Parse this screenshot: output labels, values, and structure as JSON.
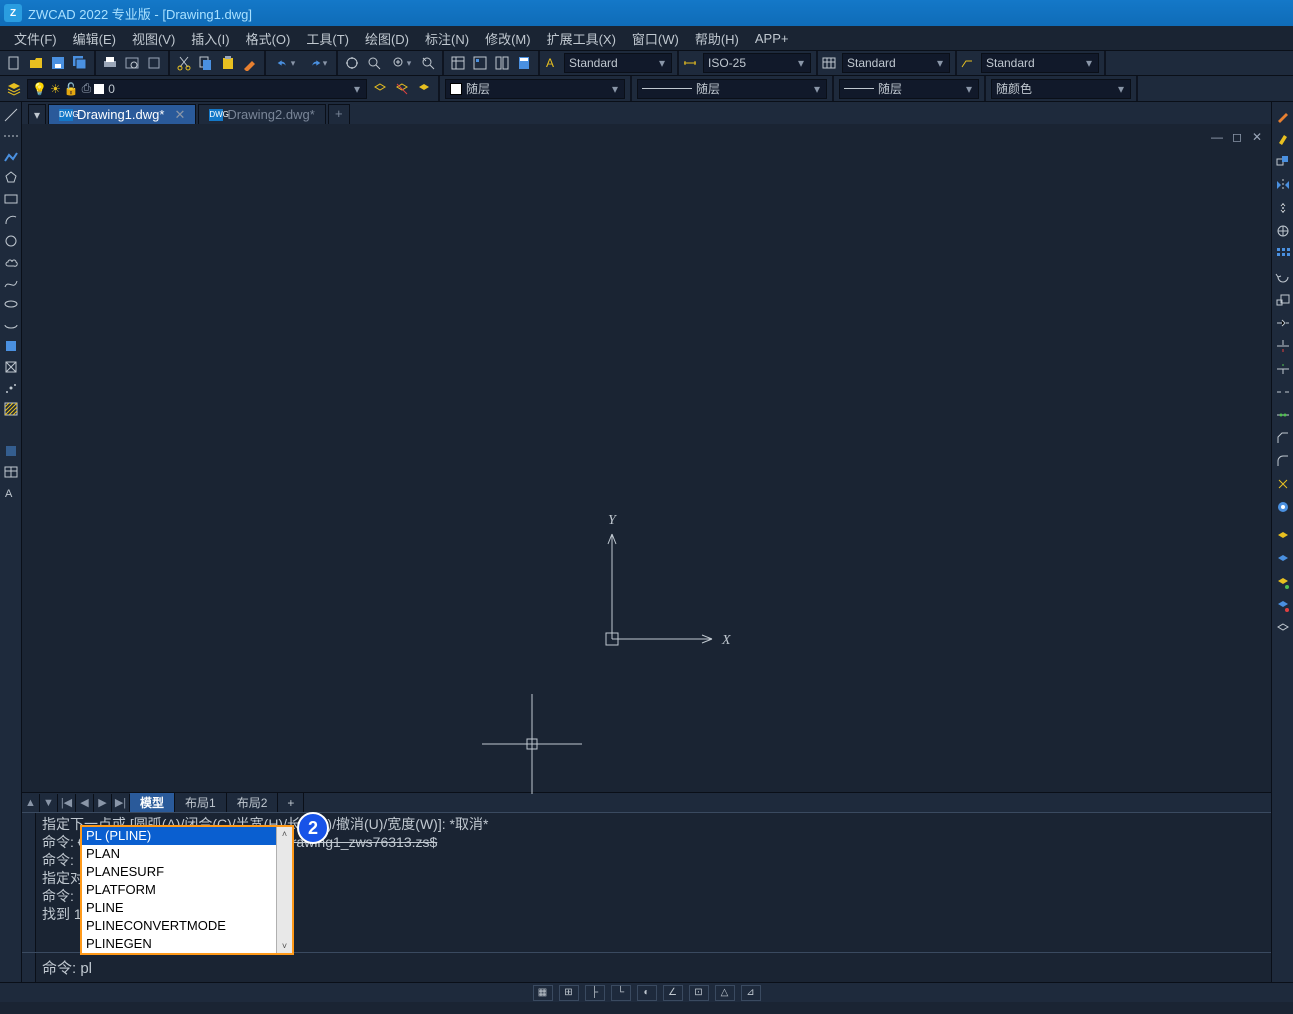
{
  "title": "ZWCAD 2022 专业版 - [Drawing1.dwg]",
  "menubar": [
    "文件(F)",
    "编辑(E)",
    "视图(V)",
    "插入(I)",
    "格式(O)",
    "工具(T)",
    "绘图(D)",
    "标注(N)",
    "修改(M)",
    "扩展工具(X)",
    "窗口(W)",
    "帮助(H)",
    "APP+"
  ],
  "standard_dd": {
    "text_style": "Standard",
    "dim_style": "ISO-25",
    "table_style": "Standard",
    "mleader_style": "Standard"
  },
  "layer_dd": {
    "layer": "0"
  },
  "props": {
    "color": "随层",
    "linetype": "随层",
    "lineweight": "随层",
    "plotstyle": "随颜色"
  },
  "tabs": {
    "active": "Drawing1.dwg*",
    "inactive": "Drawing2.dwg*"
  },
  "ucs": {
    "x": "X",
    "y": "Y"
  },
  "viewport_ctrl": {
    "min": "—",
    "restore": "◻",
    "close": "✕"
  },
  "nav_btns": {
    "up": "▲",
    "down": "▼",
    "first": "|◀",
    "prev": "◀",
    "next": "▶",
    "last": "▶|"
  },
  "layout_tabs": {
    "model": "模型",
    "layout1": "布局1",
    "layout2": "布局2",
    "add": "+"
  },
  "cmd_history": {
    "l1": "指定下一点或 [圆弧(A)/闭合(C)/半宽(H)/长度(L)/撤消(U)/宽度(W)]: *取消*",
    "l2_pre": "命令: ",
    "l2_path": "C:\\Users\\1\\AppData\\Local\\Temp\\Drawing1_zws76313.zs$",
    "l3": "命令:",
    "l4": "指定对",
    "l5": "命令:",
    "l6": "找到 1"
  },
  "autocomplete": {
    "sel": "PL (PLINE)",
    "items": [
      "PLAN",
      "PLANESURF",
      "PLATFORM",
      "PLINE",
      "PLINECONVERTMODE",
      "PLINEGEN"
    ]
  },
  "badge": "2",
  "cmd_input": {
    "prompt": "命令: ",
    "text": "pl"
  },
  "statusbar_items": [
    "▦",
    "⊞",
    "├",
    "└",
    "◐",
    "∠",
    "⊡",
    "△",
    "⊿"
  ],
  "left_tools": [
    "line",
    "xline",
    "pline",
    "polygon",
    "rect",
    "arc",
    "circle",
    "revcloud",
    "spline",
    "ellipse",
    "earc",
    "point",
    "block",
    "hatch",
    "region",
    "table",
    "mtext"
  ],
  "right_tools": [
    "match",
    "lens",
    "layers",
    "color",
    "ltype",
    "lweight",
    "dim",
    "mirror",
    "offset",
    "array",
    "move",
    "rotate",
    "scale",
    "stretch",
    "trim",
    "extend",
    "break",
    "join",
    "chamfer",
    "fillet",
    "explode",
    "sep",
    "layer1",
    "layer2",
    "layer3",
    "layer4"
  ]
}
